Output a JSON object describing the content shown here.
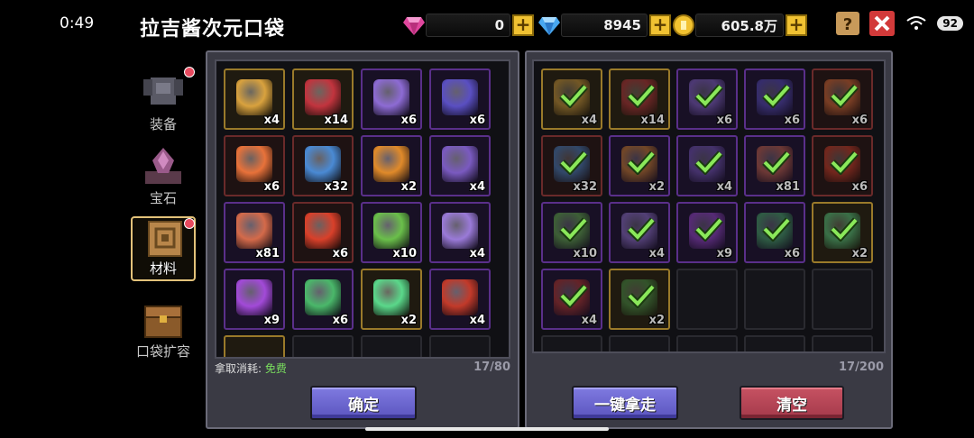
{
  "status": {
    "time": "0:49",
    "battery": "92"
  },
  "header": {
    "title": "拉吉酱次元口袋"
  },
  "currencies": [
    {
      "name": "pink-gem",
      "value": "0",
      "color": "#e0479e"
    },
    {
      "name": "blue-diamond",
      "value": "8945",
      "color": "#49a8f0"
    },
    {
      "name": "gold-coin",
      "value": "605.8万",
      "color": "#f2c230"
    }
  ],
  "tabs": [
    {
      "key": "equipment",
      "label": "装备",
      "badge": true,
      "active": false
    },
    {
      "key": "gem",
      "label": "宝石",
      "badge": false,
      "active": false
    },
    {
      "key": "material",
      "label": "材料",
      "badge": true,
      "active": true
    },
    {
      "key": "expand",
      "label": "口袋扩容",
      "badge": false,
      "active": false
    }
  ],
  "left_panel": {
    "items": [
      {
        "icon": "pickaxe-icon",
        "count": "x4",
        "frame": "gold",
        "color": "#d9a23e"
      },
      {
        "icon": "red-crystal-icon",
        "count": "x14",
        "frame": "gold",
        "color": "#c2343e"
      },
      {
        "icon": "bell-icon",
        "count": "x6",
        "frame": "purple",
        "color": "#8d6bd4"
      },
      {
        "icon": "wrench-icon",
        "count": "x6",
        "frame": "purple",
        "color": "#5a4fc2"
      },
      {
        "icon": "campfire-icon",
        "count": "x6",
        "frame": "red",
        "color": "#e8723a"
      },
      {
        "icon": "snowflake-orb-icon",
        "count": "x32",
        "frame": "red",
        "color": "#4a8ad4"
      },
      {
        "icon": "ring-icon",
        "count": "x2",
        "frame": "purple",
        "color": "#e08a2a"
      },
      {
        "icon": "chip-icon",
        "count": "x4",
        "frame": "purple",
        "color": "#7a5ac0"
      },
      {
        "icon": "ore-icon",
        "count": "x81",
        "frame": "purple",
        "color": "#d46a4a"
      },
      {
        "icon": "flame-core-icon",
        "count": "x6",
        "frame": "red",
        "color": "#d9402a"
      },
      {
        "icon": "cactus-icon",
        "count": "x10",
        "frame": "purple",
        "color": "#6abf4a"
      },
      {
        "icon": "horn-icon",
        "count": "x4",
        "frame": "purple",
        "color": "#9a7ad8"
      },
      {
        "icon": "potion-icon",
        "count": "x9",
        "frame": "purple",
        "color": "#a24ad8"
      },
      {
        "icon": "slime-icon",
        "count": "x6",
        "frame": "purple",
        "color": "#4ab86a"
      },
      {
        "icon": "star-seal-icon",
        "count": "x2",
        "frame": "gold",
        "color": "#5ad88a"
      },
      {
        "icon": "red-orb-icon",
        "count": "x4",
        "frame": "purple",
        "color": "#c23a2a"
      }
    ],
    "cost_label": "拿取消耗:",
    "cost_value": "免费",
    "capacity": "17/80",
    "confirm_label": "确定"
  },
  "right_panel": {
    "items": [
      {
        "icon": "pickaxe-icon",
        "count": "x4",
        "frame": "gold",
        "color": "#d9a23e"
      },
      {
        "icon": "red-crystal-icon",
        "count": "x14",
        "frame": "gold",
        "color": "#c2343e"
      },
      {
        "icon": "bell-icon",
        "count": "x6",
        "frame": "purple",
        "color": "#8d6bd4"
      },
      {
        "icon": "wrench-icon",
        "count": "x6",
        "frame": "purple",
        "color": "#5a4fc2"
      },
      {
        "icon": "campfire-icon",
        "count": "x6",
        "frame": "red",
        "color": "#e8723a"
      },
      {
        "icon": "snowflake-orb-icon",
        "count": "x32",
        "frame": "red",
        "color": "#4a8ad4"
      },
      {
        "icon": "ring-icon",
        "count": "x2",
        "frame": "purple",
        "color": "#e08a2a"
      },
      {
        "icon": "chip-icon",
        "count": "x4",
        "frame": "purple",
        "color": "#7a5ac0"
      },
      {
        "icon": "ore-icon",
        "count": "x81",
        "frame": "purple",
        "color": "#d46a4a"
      },
      {
        "icon": "flame-core-icon",
        "count": "x6",
        "frame": "red",
        "color": "#d9402a"
      },
      {
        "icon": "cactus-icon",
        "count": "x10",
        "frame": "purple",
        "color": "#6abf4a"
      },
      {
        "icon": "horn-icon",
        "count": "x4",
        "frame": "purple",
        "color": "#9a7ad8"
      },
      {
        "icon": "potion-icon",
        "count": "x9",
        "frame": "purple",
        "color": "#a24ad8"
      },
      {
        "icon": "slime-icon",
        "count": "x6",
        "frame": "purple",
        "color": "#4ab86a"
      },
      {
        "icon": "star-seal-icon",
        "count": "x2",
        "frame": "gold",
        "color": "#5ad88a"
      },
      {
        "icon": "red-orb-icon",
        "count": "x4",
        "frame": "purple",
        "color": "#c23a2a"
      },
      {
        "icon": "leaf-icon",
        "count": "x2",
        "frame": "gold",
        "color": "#4a9a4a"
      }
    ],
    "capacity": "17/200",
    "take_all_label": "一键拿走",
    "clear_label": "清空"
  }
}
